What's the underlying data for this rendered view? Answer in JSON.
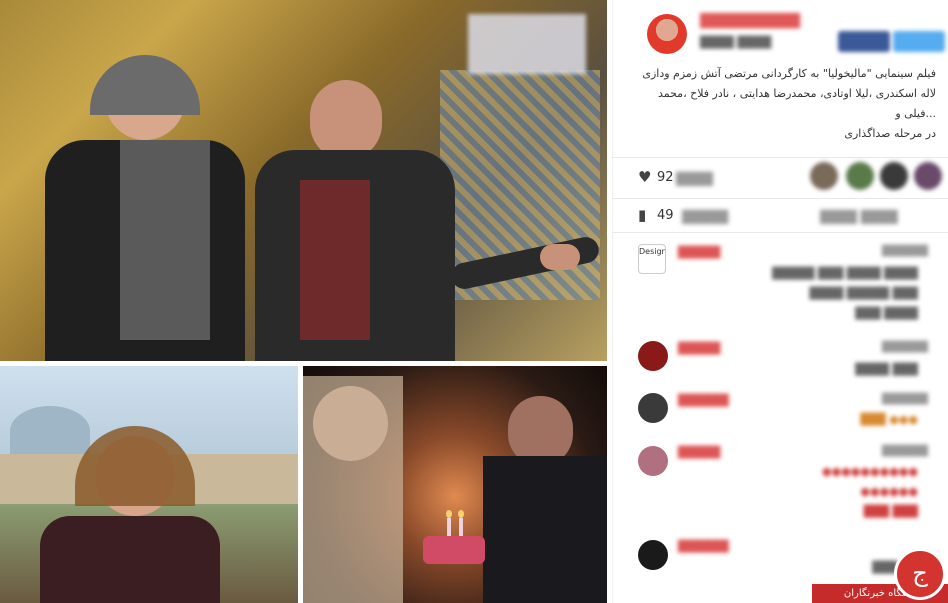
{
  "post": {
    "caption_line1": "فیلم سینمایی \"مالیخولیا\" به کارگردانی مرتضی آتش زمزم ودازی",
    "caption_line2": "لاله اسکندری ،لیلا اوتادی، محمدرضا هدایتی ، نادر فلاح ،محمد",
    "caption_line3": "...فیلی و",
    "caption_line4": "در مرحله صداگذاری",
    "likes_count": "92",
    "comments_count": "49",
    "comment_logo_text": "Design"
  },
  "watermark": {
    "site_name": "باشگاه خبرنگاران",
    "badge_glyph": "ج"
  },
  "icons": {
    "heart": "heart-icon",
    "comment": "comment-icon"
  },
  "colors": {
    "watermark_red": "#c62b2b",
    "username_red": "#e05858",
    "facebook_blue": "#3b5998",
    "twitter_blue": "#55acee"
  }
}
